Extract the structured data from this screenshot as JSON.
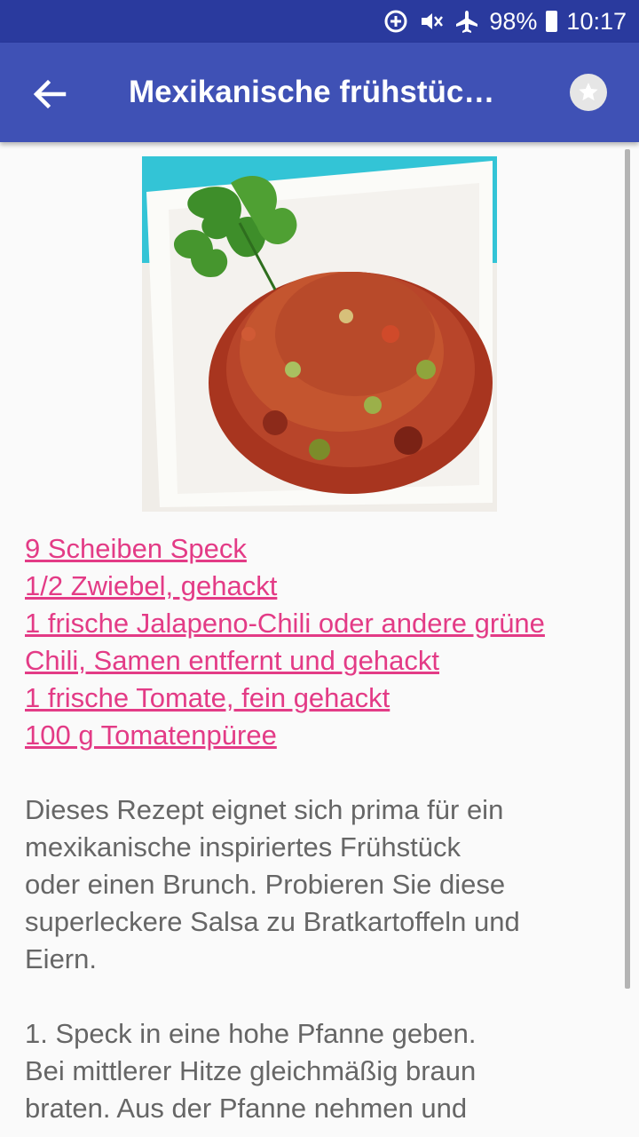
{
  "status_bar": {
    "battery": "98%",
    "time": "10:17",
    "icons": [
      "data-saver-icon",
      "mute-vibrate-icon",
      "airplane-icon",
      "battery-icon"
    ]
  },
  "app_bar": {
    "title": "Mexikanische frühstüc…",
    "back_icon": "arrow-left-icon",
    "favorite_icon": "star-icon"
  },
  "recipe": {
    "ingredients": [
      "9 Scheiben Speck",
      "1/2 Zwiebel, gehackt",
      "1 frische Jalapeno-Chili oder andere grüne",
      "Chili, Samen entfernt und gehackt",
      "1 frische Tomate, fein gehackt",
      "100 g Tomatenpüree"
    ],
    "description": "Dieses Rezept eignet sich prima für ein\nmexikanische inspiriertes Frühstück\noder einen Brunch. Probieren Sie diese\nsuperleckere Salsa zu Bratkartoffeln und\nEiern.",
    "step": "1. Speck in eine hohe Pfanne geben.\nBei mittlerer Hitze gleichmäßig braun\nbraten. Aus der Pfanne nehmen und"
  },
  "colors": {
    "status_bar": "#2a3a9e",
    "app_bar": "#3f51b5",
    "link": "#e33b86",
    "body_text": "#666666"
  }
}
